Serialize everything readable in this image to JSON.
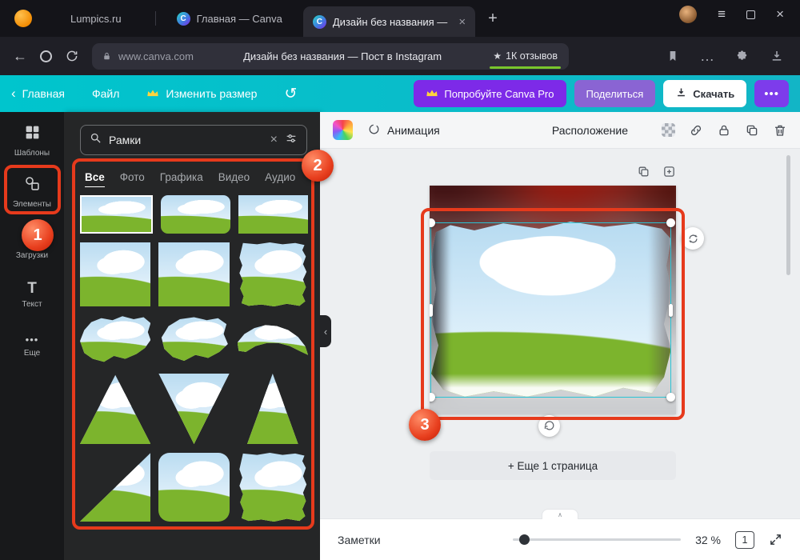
{
  "icons": {
    "back_arrow": "←",
    "menu": "≡",
    "close": "×",
    "new_tab": "+",
    "star": "★",
    "dots": "…",
    "chevron_left": "‹",
    "chevron_up": "∧",
    "undo": "↺",
    "more_dots": "•••",
    "text_tool": "T",
    "canva_favicon": "C",
    "window_close": "×"
  },
  "browser": {
    "tabs": [
      {
        "label": "Lumpics.ru"
      },
      {
        "label": "Главная — Canva"
      },
      {
        "label": "Дизайн без названия —"
      }
    ],
    "address": {
      "url": "www.canva.com",
      "title": "Дизайн без названия — Пост в Instagram",
      "reviews": "1К отзывов"
    }
  },
  "header": {
    "back_label": "Главная",
    "file_label": "Файл",
    "resize_label": "Изменить размер",
    "pro_label": "Попробуйте Canva Pro",
    "share_label": "Поделиться",
    "download_label": "Скачать"
  },
  "sidebar": {
    "items": [
      {
        "label": "Шаблоны"
      },
      {
        "label": "Элементы"
      },
      {
        "label": "Загрузки"
      },
      {
        "label": "Текст"
      },
      {
        "label": "Еще"
      }
    ]
  },
  "panel": {
    "search_value": "Рамки",
    "tabs": [
      {
        "label": "Все"
      },
      {
        "label": "Фото"
      },
      {
        "label": "Графика"
      },
      {
        "label": "Видео"
      },
      {
        "label": "Аудио"
      }
    ]
  },
  "canvas": {
    "animation_label": "Анимация",
    "position_label": "Расположение",
    "add_page_label": "+ Еще 1 страница",
    "notes_label": "Заметки",
    "zoom_value": "32 %",
    "page_number": "1"
  },
  "annotations": {
    "steps": [
      "1",
      "2",
      "3"
    ]
  },
  "colors": {
    "annotation_red": "#e63a1c",
    "canva_teal": "#00c4cc",
    "canva_purple": "#7d2ae8",
    "selection_teal": "#2bc3d4",
    "reviews_green": "#79c62c"
  }
}
